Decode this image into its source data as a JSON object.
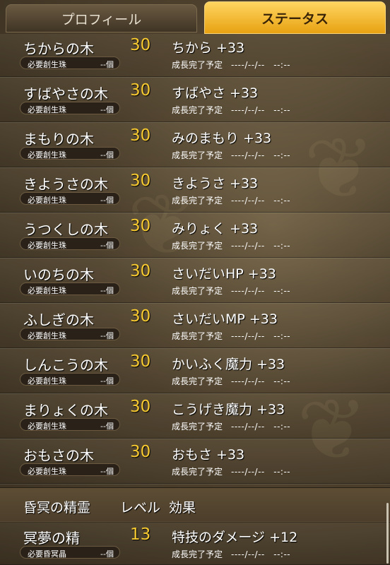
{
  "tabs": [
    {
      "label": "プロフィール",
      "active": false
    },
    {
      "label": "ステータス",
      "active": true
    }
  ],
  "colors": {
    "accent": "#f6c930",
    "tab_active": "#f3b935",
    "background": "#4f422e"
  },
  "pill_label": "必要創生珠",
  "pill_value": "--個",
  "schedule_label": "成長完了予定",
  "schedule_value": "----/--/--　--:--",
  "trees": [
    {
      "name": "ちからの木",
      "level": "30",
      "effect": "ちから +33"
    },
    {
      "name": "すばやさの木",
      "level": "30",
      "effect": "すばやさ +33"
    },
    {
      "name": "まもりの木",
      "level": "30",
      "effect": "みのまもり +33"
    },
    {
      "name": "きようさの木",
      "level": "30",
      "effect": "きようさ +33"
    },
    {
      "name": "うつくしの木",
      "level": "30",
      "effect": "みりょく +33"
    },
    {
      "name": "いのちの木",
      "level": "30",
      "effect": "さいだいHP +33"
    },
    {
      "name": "ふしぎの木",
      "level": "30",
      "effect": "さいだいMP +33"
    },
    {
      "name": "しんこうの木",
      "level": "30",
      "effect": "かいふく魔力 +33"
    },
    {
      "name": "まりょくの木",
      "level": "30",
      "effect": "こうげき魔力 +33"
    },
    {
      "name": "おもさの木",
      "level": "30",
      "effect": "おもさ +33"
    }
  ],
  "spirit_header": {
    "title": "昏冥の精霊",
    "level_col": "レベル",
    "effect_col": "効果"
  },
  "spirit": {
    "name": "冥夢の精",
    "level": "13",
    "effect": "特技のダメージ +12",
    "pill_label": "必要昏冥晶",
    "pill_value": "--個",
    "schedule_label": "成長完了予定",
    "schedule_value": "----/--/--　--:--"
  }
}
